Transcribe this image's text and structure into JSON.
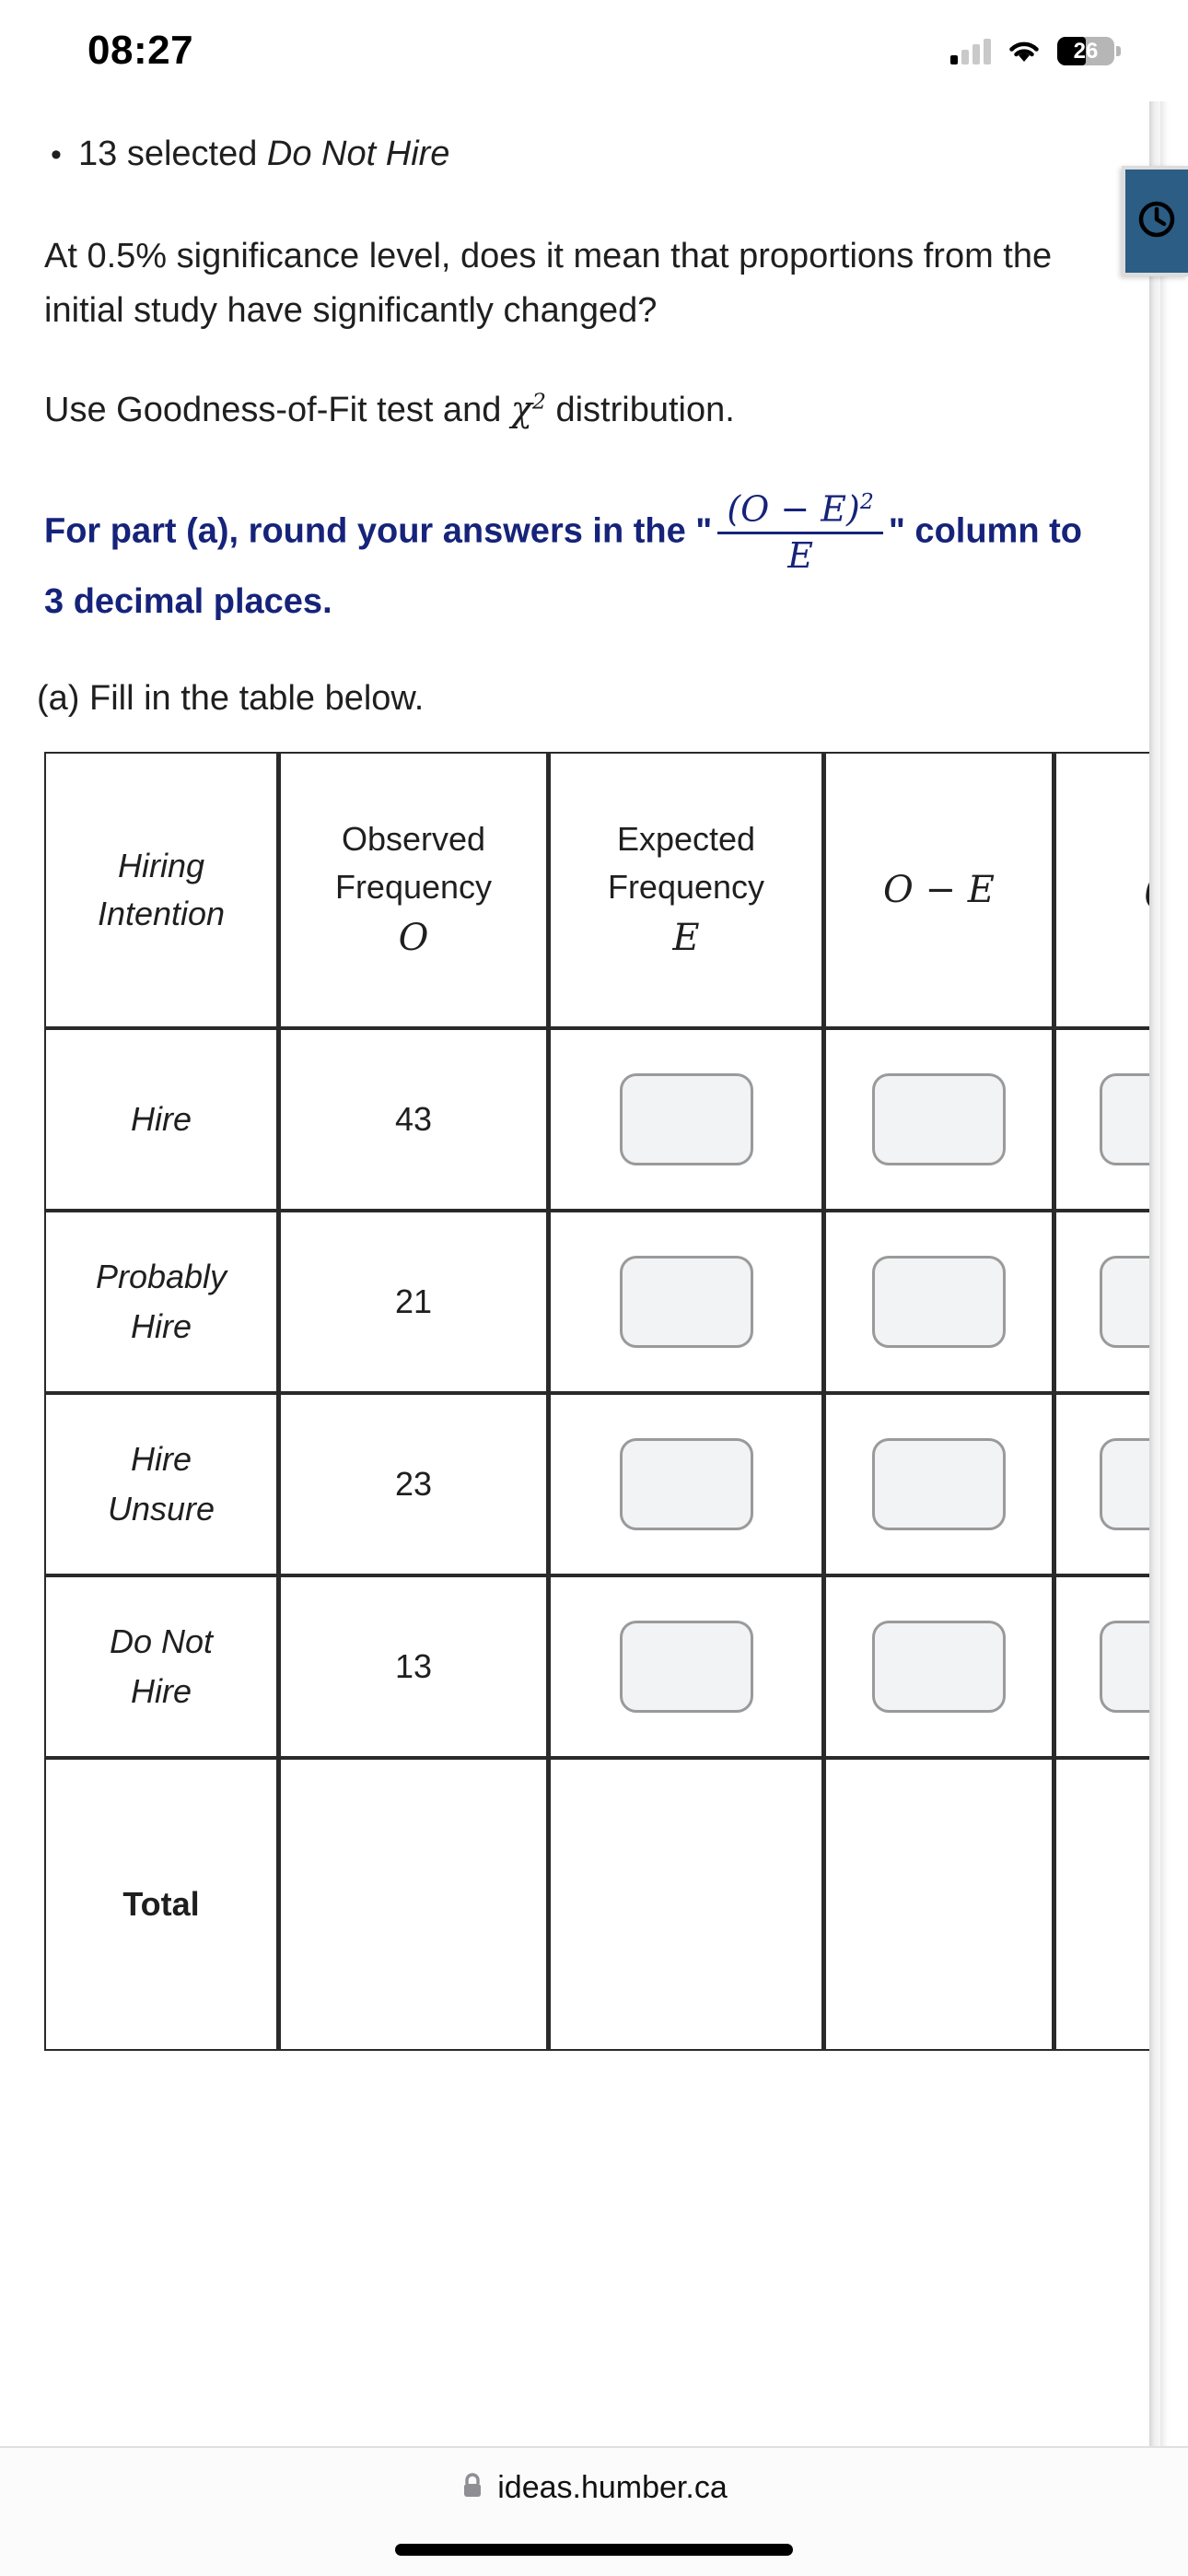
{
  "status_bar": {
    "time": "08:27",
    "battery_percent": "26",
    "icons": [
      "cellular-signal-icon",
      "wifi-icon",
      "battery-icon"
    ]
  },
  "floating_tab": {
    "icon": "clock-icon",
    "color": "#2b5d85"
  },
  "document": {
    "bullet": {
      "marker": "•",
      "prefix": "13 selected ",
      "emphasis": "Do Not Hire"
    },
    "paragraph_1": "At 0.5% significance level, does it mean that proportions from the initial study have significantly changed?",
    "paragraph_2_prefix": "Use Goodness-of-Fit test and ",
    "paragraph_2_chi": "χ",
    "paragraph_2_exp": "2",
    "paragraph_2_suffix": " distribution.",
    "blue_note": {
      "lead": "For part (a), round your answers in the \"",
      "fraction_numerator": "(O − E)",
      "fraction_numerator_exponent": "2",
      "fraction_denominator": "E",
      "trail": "\" column to 3 decimal places.",
      "color": "#16237a"
    },
    "sub_question": "(a) Fill in the table below."
  },
  "table": {
    "headers": [
      {
        "line1": "Hiring",
        "line2": "Intention",
        "italic": true
      },
      {
        "line1": "Observed",
        "line2": "Frequency",
        "line3": "O"
      },
      {
        "line1": "Expected",
        "line2": "Frequency",
        "line3": "E"
      },
      {
        "math": "O − E"
      },
      {
        "math_partial": "(O"
      }
    ],
    "rows": [
      {
        "label_line1": "Hire",
        "label_line2": "",
        "observed": "43",
        "expected": "",
        "o_minus_e": "",
        "sq_over_e": ""
      },
      {
        "label_line1": "Probably",
        "label_line2": "Hire",
        "observed": "21",
        "expected": "",
        "o_minus_e": "",
        "sq_over_e": ""
      },
      {
        "label_line1": "Hire",
        "label_line2": "Unsure",
        "observed": "23",
        "expected": "",
        "o_minus_e": "",
        "sq_over_e": ""
      },
      {
        "label_line1": "Do Not",
        "label_line2": "Hire",
        "observed": "13",
        "expected": "",
        "o_minus_e": "",
        "sq_over_e": ""
      }
    ],
    "total_label": "Total",
    "input_placeholder": ""
  },
  "browser_bar": {
    "lock_icon": "lock-icon",
    "url": "ideas.humber.ca"
  }
}
